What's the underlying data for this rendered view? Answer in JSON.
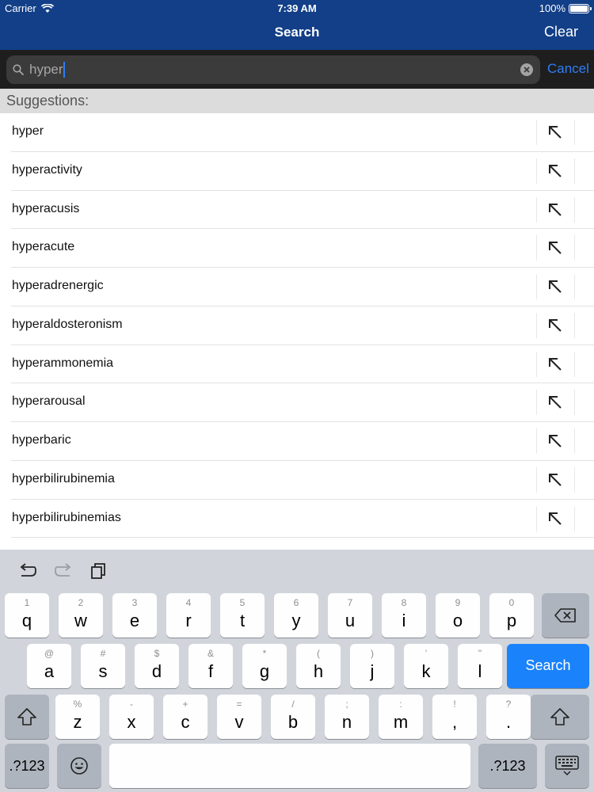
{
  "status": {
    "carrier": "Carrier",
    "time": "7:39 AM",
    "battery": "100%"
  },
  "nav": {
    "title": "Search",
    "clear_label": "Clear"
  },
  "search": {
    "value": "hyper",
    "cancel_label": "Cancel"
  },
  "suggestions": {
    "header": "Suggestions:",
    "items": [
      "hyper",
      "hyperactivity",
      "hyperacusis",
      "hyperacute",
      "hyperadrenergic",
      "hyperaldosteronism",
      "hyperammonemia",
      "hyperarousal",
      "hyperbaric",
      "hyperbilirubinemia",
      "hyperbilirubinemias"
    ]
  },
  "keyboard": {
    "row1": [
      {
        "hint": "1",
        "main": "q"
      },
      {
        "hint": "2",
        "main": "w"
      },
      {
        "hint": "3",
        "main": "e"
      },
      {
        "hint": "4",
        "main": "r"
      },
      {
        "hint": "5",
        "main": "t"
      },
      {
        "hint": "6",
        "main": "y"
      },
      {
        "hint": "7",
        "main": "u"
      },
      {
        "hint": "8",
        "main": "i"
      },
      {
        "hint": "9",
        "main": "o"
      },
      {
        "hint": "0",
        "main": "p"
      }
    ],
    "row2": [
      {
        "hint": "@",
        "main": "a"
      },
      {
        "hint": "#",
        "main": "s"
      },
      {
        "hint": "$",
        "main": "d"
      },
      {
        "hint": "&",
        "main": "f"
      },
      {
        "hint": "*",
        "main": "g"
      },
      {
        "hint": "(",
        "main": "h"
      },
      {
        "hint": ")",
        "main": "j"
      },
      {
        "hint": "’",
        "main": "k"
      },
      {
        "hint": "\"",
        "main": "l"
      }
    ],
    "row3": [
      {
        "hint": "%",
        "main": "z"
      },
      {
        "hint": "-",
        "main": "x"
      },
      {
        "hint": "+",
        "main": "c"
      },
      {
        "hint": "=",
        "main": "v"
      },
      {
        "hint": "/",
        "main": "b"
      },
      {
        "hint": ";",
        "main": "n"
      },
      {
        "hint": ":",
        "main": "m"
      },
      {
        "hint": "!",
        "main": ","
      },
      {
        "hint": "?",
        "main": "."
      }
    ],
    "search_label": "Search",
    "numbers_label": ".?123"
  },
  "colors": {
    "nav_bg": "#123f87",
    "accent": "#2f7df6",
    "search_key": "#1a82fb"
  }
}
